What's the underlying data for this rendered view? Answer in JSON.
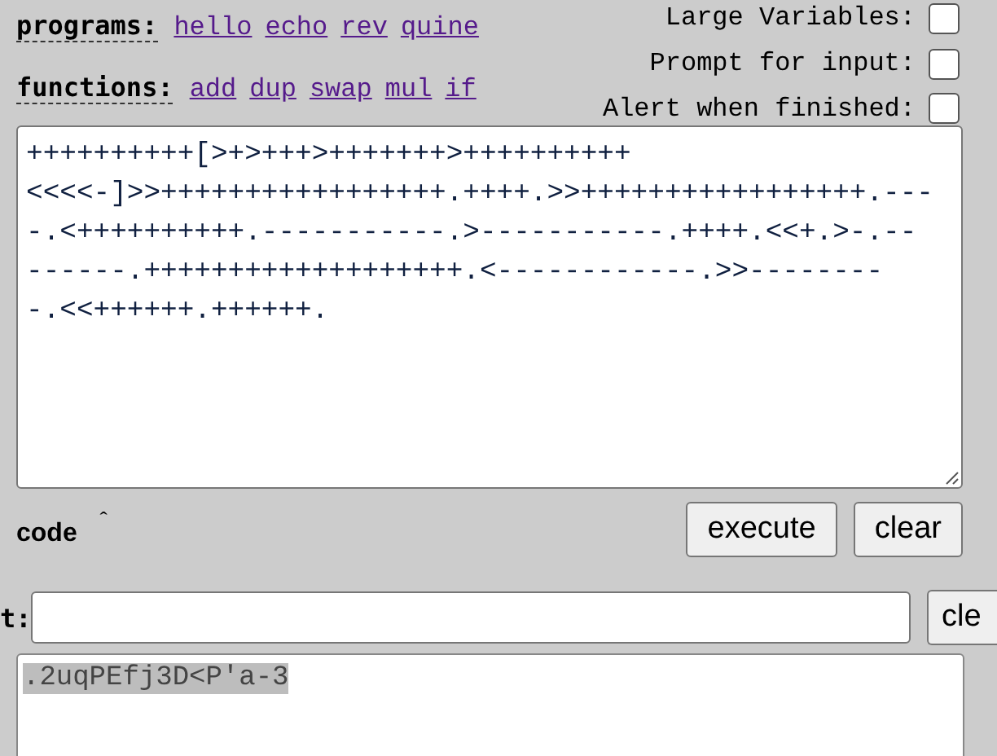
{
  "programs": {
    "label": "programs:",
    "links": [
      "hello",
      "echo",
      "rev",
      "quine"
    ]
  },
  "functions": {
    "label": "functions:",
    "links": [
      "add",
      "dup",
      "swap",
      "mul",
      "if"
    ]
  },
  "options": [
    {
      "label": "Large Variables:",
      "checked": false
    },
    {
      "label": "Prompt for input:",
      "checked": false
    },
    {
      "label": "Alert when finished:",
      "checked": false
    }
  ],
  "code": {
    "lines": [
      "++++++++++[>+>+++>+++++++>++++++++++",
      "<<<<-]>>+++++++++++++++++.++++.>>+++++++++++++++++.---",
      "-.<++++++++++.-----------.>-----------.++++.<<+.>-.--",
      "------.+++++++++++++++++++.<------------.>>--------",
      "-.<<++++++.++++++."
    ],
    "label": "code",
    "toggle": "ˆ"
  },
  "buttons": [
    "execute",
    "clear"
  ],
  "input": {
    "label": "t:",
    "button": "cle"
  },
  "output": {
    "text": ".2uqPEfj3D<P'a-3",
    "selected": true
  }
}
